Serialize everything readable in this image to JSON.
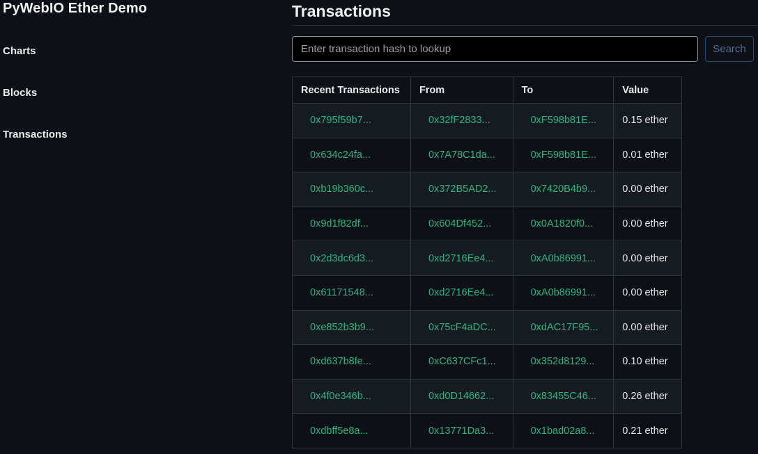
{
  "sidebar": {
    "brand": "PyWebIO Ether Demo",
    "items": [
      {
        "label": "Charts"
      },
      {
        "label": "Blocks"
      },
      {
        "label": "Transactions"
      }
    ]
  },
  "main": {
    "title": "Transactions",
    "search": {
      "placeholder": "Enter transaction hash to lookup",
      "value": "",
      "button_label": "Search"
    },
    "table": {
      "headers": [
        "Recent Transactions",
        "From",
        "To",
        "Value"
      ],
      "rows": [
        {
          "hash": "0x795f59b7...",
          "from": "0x32fF2833...",
          "to": "0xF598b81E...",
          "value": "0.15 ether"
        },
        {
          "hash": "0x634c24fa...",
          "from": "0x7A78C1da...",
          "to": "0xF598b81E...",
          "value": "0.01 ether"
        },
        {
          "hash": "0xb19b360c...",
          "from": "0x372B5AD2...",
          "to": "0x7420B4b9...",
          "value": "0.00 ether"
        },
        {
          "hash": "0x9d1f82df...",
          "from": "0x604Df452...",
          "to": "0x0A1820f0...",
          "value": "0.00 ether"
        },
        {
          "hash": "0x2d3dc6d3...",
          "from": "0xd2716Ee4...",
          "to": "0xA0b86991...",
          "value": "0.00 ether"
        },
        {
          "hash": "0x61171548...",
          "from": "0xd2716Ee4...",
          "to": "0xA0b86991...",
          "value": "0.00 ether"
        },
        {
          "hash": "0xe852b3b9...",
          "from": "0x75cF4aDC...",
          "to": "0xdAC17F95...",
          "value": "0.00 ether"
        },
        {
          "hash": "0xd637b8fe...",
          "from": "0xC637CFc1...",
          "to": "0x352d8129...",
          "value": "0.10 ether"
        },
        {
          "hash": "0x4f0e346b...",
          "from": "0xd0D14662...",
          "to": "0x83455C46...",
          "value": "0.26 ether"
        },
        {
          "hash": "0xdbff5e8a...",
          "from": "0x13771Da3...",
          "to": "0x1bad02a8...",
          "value": "0.21 ether"
        }
      ]
    }
  },
  "colors": {
    "background": "#0d1117",
    "link": "#2fb37f",
    "row_alt": "#161b22",
    "search_button": "#4a6d93"
  }
}
